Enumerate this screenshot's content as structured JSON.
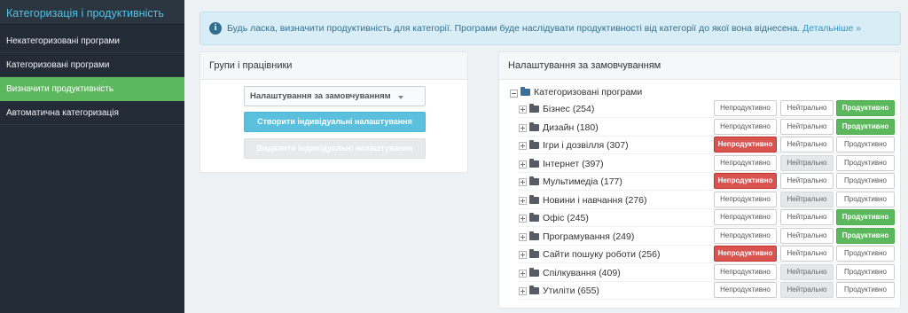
{
  "sidebar": {
    "title": "Категоризація і продуктивність",
    "items": [
      {
        "label": "Некатегоризовані програми"
      },
      {
        "label": "Категоризовані програми"
      },
      {
        "label": "Визначити продуктивність"
      },
      {
        "label": "Автоматична категоризація"
      }
    ],
    "active_index": 2
  },
  "alert": {
    "text": "Будь ласка, визначити продуктивність для категорії. Програми буде наслідувати продуктивності від категорії до якої вона віднесена.",
    "link": "Детальніше »"
  },
  "groups_panel": {
    "title": "Групи і працівники",
    "select_value": "Налаштування за замовчуванням",
    "create_button": "Створити індивідуальні налаштування",
    "delete_button": "Видалити індивідуальні налаштування"
  },
  "defaults_panel": {
    "title": "Налаштування за замовчуванням",
    "root_label": "Категоризовані програми",
    "labels": {
      "unproductive": "Непродуктивно",
      "neutral": "Нейтрально",
      "productive": "Продуктивно"
    },
    "rows": [
      {
        "label": "Бізнес (254)",
        "state": "productive"
      },
      {
        "label": "Дизайн (180)",
        "state": "productive"
      },
      {
        "label": "Ігри і дозвілля (307)",
        "state": "unproductive"
      },
      {
        "label": "Інтернет (397)",
        "state": "neutral"
      },
      {
        "label": "Мультимедіа (177)",
        "state": "unproductive"
      },
      {
        "label": "Новини і навчання (276)",
        "state": "neutral"
      },
      {
        "label": "Офіс (245)",
        "state": "productive"
      },
      {
        "label": "Програмування (249)",
        "state": "productive"
      },
      {
        "label": "Сайти пошуку роботи (256)",
        "state": "unproductive"
      },
      {
        "label": "Спілкування (409)",
        "state": "neutral"
      },
      {
        "label": "Утиліти (655)",
        "state": "neutral"
      }
    ]
  },
  "colors": {
    "accent_blue": "#4fc3e8",
    "active_green": "#5cb85c",
    "unproductive_red": "#d9534f",
    "info_blue": "#5bc0de"
  }
}
